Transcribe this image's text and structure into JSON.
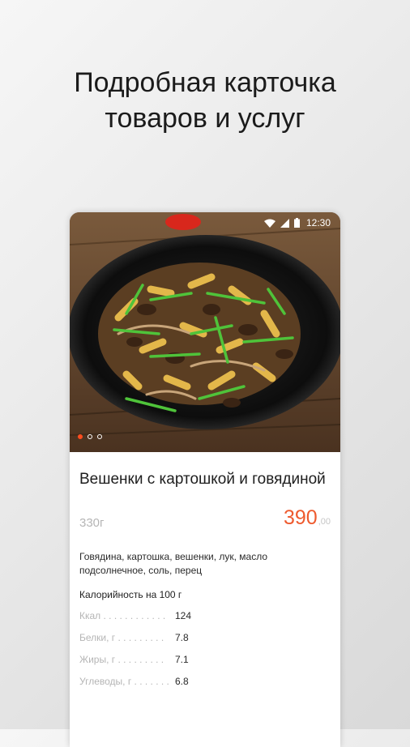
{
  "headline": {
    "line1": "Подробная карточка",
    "line2": "товаров и услуг"
  },
  "status_bar": {
    "time": "12:30",
    "icons": [
      "wifi-icon",
      "signal-icon",
      "battery-icon"
    ]
  },
  "product": {
    "image_alt_icon": "food-photo",
    "carousel": {
      "count": 3,
      "active_index": 0
    },
    "title": "Вешенки с картошкой и говядиной",
    "weight": "330г",
    "price_main": "390",
    "price_cents": ",00",
    "ingredients": "Говядина, картошка, вешенки, лук, масло подсолнечное, соль, перец",
    "calorie_heading": "Калорийность на 100 г",
    "nutrition": [
      {
        "label": "Ккал . . . . . . . . . . . .",
        "value": "124"
      },
      {
        "label": "Белки, г . . . . . . . . .",
        "value": "7.8"
      },
      {
        "label": "Жиры, г . . . . . . . . .",
        "value": "7.1"
      },
      {
        "label": "Углеводы, г . . . . . . .",
        "value": "6.8"
      }
    ]
  },
  "colors": {
    "accent": "#ee5a2e",
    "muted_text": "#b5b5b5",
    "dark_text": "#1e1e1e"
  }
}
